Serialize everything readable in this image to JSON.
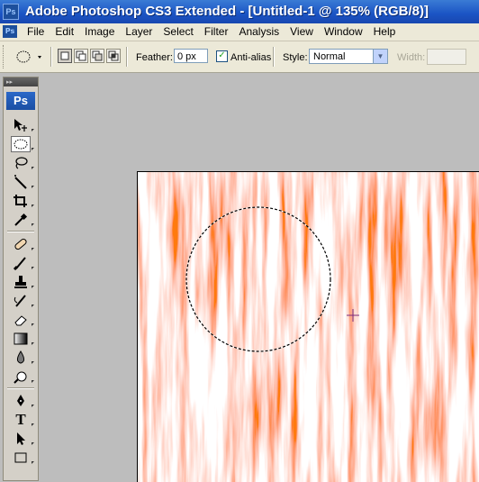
{
  "window": {
    "title": "Adobe Photoshop CS3 Extended - [Untitled-1 @ 135% (RGB/8)]",
    "app_icon": "Ps"
  },
  "menubar": {
    "app_icon": "Ps",
    "items": [
      "File",
      "Edit",
      "Image",
      "Layer",
      "Select",
      "Filter",
      "Analysis",
      "View",
      "Window",
      "Help"
    ]
  },
  "options": {
    "feather_label": "Feather:",
    "feather_value": "0 px",
    "antialias_label": "Anti-alias",
    "antialias_checked": true,
    "style_label": "Style:",
    "style_value": "Normal",
    "width_label": "Width:"
  },
  "toolbox": {
    "logo": "Ps",
    "header": "▸▸",
    "tools": [
      "move-tool",
      "elliptical-marquee-tool",
      "lasso-tool",
      "magic-wand-tool",
      "crop-tool",
      "eyedropper-tool",
      "healing-brush-tool",
      "brush-tool",
      "clone-stamp-tool",
      "history-brush-tool",
      "eraser-tool",
      "gradient-tool",
      "blur-tool",
      "dodge-tool",
      "pen-tool",
      "type-tool",
      "path-selection-tool",
      "shape-tool"
    ],
    "active_tool": "elliptical-marquee-tool",
    "type_tool_glyph": "T"
  },
  "colors": {
    "title_bar": "#1b54c4",
    "chrome": "#ece9d8",
    "canvas_orange": "#ff7a10",
    "workspace": "#bdbdbd"
  }
}
